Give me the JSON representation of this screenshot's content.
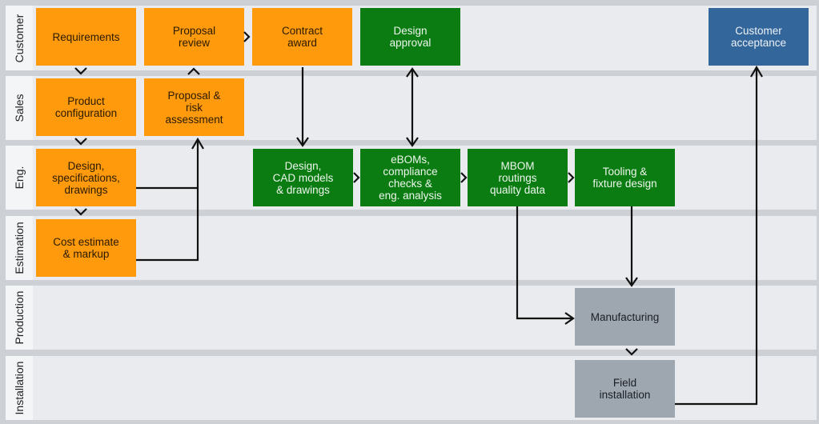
{
  "lanes": [
    "Customer",
    "Sales",
    "Eng.",
    "Estimation",
    "Production",
    "Installation"
  ],
  "boxes": {
    "requirements": "Requirements",
    "proposal_review": "Proposal\nreview",
    "contract_award": "Contract\naward",
    "design_approval": "Design\napproval",
    "customer_acceptance": "Customer\nacceptance",
    "product_configuration": "Product\nconfiguration",
    "proposal_risk": "Proposal &\nrisk\nassessment",
    "design_specs": "Design,\nspecifications,\ndrawings",
    "design_cad": "Design,\nCAD models\n& drawings",
    "eboms": "eBOMs,\ncompliance\nchecks &\neng. analysis",
    "mbom": "MBOM\nroutings\nquality data",
    "tooling": "Tooling &\nfixture design",
    "cost_estimate": "Cost estimate\n& markup",
    "manufacturing": "Manufacturing",
    "field_installation": "Field\ninstallation"
  },
  "colors": {
    "orange": "#fe9a0c",
    "green": "#0b7c12",
    "blue": "#33669a",
    "gray": "#9ea6b0"
  }
}
